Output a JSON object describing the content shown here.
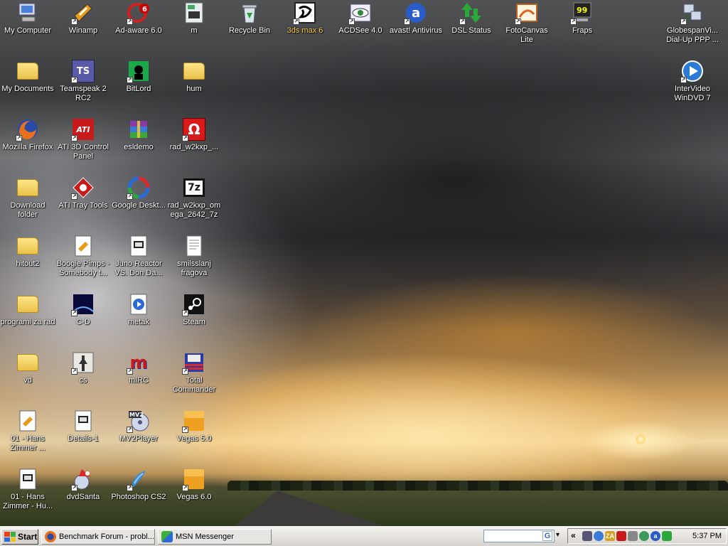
{
  "desktop": {
    "icons": [
      {
        "label": "My Computer",
        "icon": "my-computer-icon"
      },
      {
        "label": "Winamp",
        "icon": "winamp-icon"
      },
      {
        "label": "Ad-aware 6.0",
        "icon": "ad-aware-icon"
      },
      {
        "label": "m",
        "icon": "document-icon"
      },
      {
        "label": "Recycle Bin",
        "icon": "recycle-bin-icon"
      },
      {
        "label": "3ds max 6",
        "icon": "3ds-max-icon"
      },
      {
        "label": "ACDSee 4.0",
        "icon": "acdsee-icon"
      },
      {
        "label": "avast! Antivirus",
        "icon": "avast-icon"
      },
      {
        "label": "DSL Status",
        "icon": "dsl-status-icon"
      },
      {
        "label": "FotoCanvas Lite",
        "icon": "fotocanvas-icon"
      },
      {
        "label": "Fraps",
        "icon": "fraps-icon",
        "badge": "99"
      },
      {
        "label": "GlobespanVi... Dial-Up PPP ...",
        "icon": "network-icon"
      },
      {
        "label": "My Documents",
        "icon": "my-documents-icon"
      },
      {
        "label": "Teamspeak 2 RC2",
        "icon": "teamspeak-icon",
        "badge": "TS"
      },
      {
        "label": "BitLord",
        "icon": "bitlord-icon"
      },
      {
        "label": "hum",
        "icon": "folder-icon"
      },
      {
        "label": "InterVideo WinDVD 7",
        "icon": "windvd-icon"
      },
      {
        "label": "Mozilla Firefox",
        "icon": "firefox-icon"
      },
      {
        "label": "ATI 3D Control Panel",
        "icon": "ati-icon",
        "badge": "ATI"
      },
      {
        "label": "esldemo",
        "icon": "archive-icon"
      },
      {
        "label": "rad_w2kxp_...",
        "icon": "omega-icon",
        "badge": "Ω"
      },
      {
        "label": "Download folder",
        "icon": "folder-icon"
      },
      {
        "label": "ATI Tray Tools",
        "icon": "ati-tray-icon"
      },
      {
        "label": "Google Deskt...",
        "icon": "google-desktop-icon"
      },
      {
        "label": "rad_w2kxp_omega_2642_7z",
        "icon": "7zip-icon",
        "badge": "7z"
      },
      {
        "label": "hitout2",
        "icon": "folder-icon"
      },
      {
        "label": "Boogie Pimps - Somebody t...",
        "icon": "audio-file-icon"
      },
      {
        "label": "Juno Reactor VS. Don Da...",
        "icon": "media-file-icon"
      },
      {
        "label": "smilsslanj fragova",
        "icon": "text-file-icon"
      },
      {
        "label": "programi za rad",
        "icon": "folder-icon"
      },
      {
        "label": "C-D",
        "icon": "cd-icon"
      },
      {
        "label": "metak",
        "icon": "media-player-icon"
      },
      {
        "label": "Steam",
        "icon": "steam-icon"
      },
      {
        "label": "vd",
        "icon": "folder-icon"
      },
      {
        "label": "cs",
        "icon": "counter-strike-icon"
      },
      {
        "label": "mIRC",
        "icon": "mirc-icon",
        "badge": "m"
      },
      {
        "label": "Total Commander",
        "icon": "total-commander-icon"
      },
      {
        "label": "01 - Hans Zimmer ...",
        "icon": "audio-file-icon"
      },
      {
        "label": "Details-1",
        "icon": "media-file-icon"
      },
      {
        "label": "MV2Player",
        "icon": "mv2player-icon",
        "badge": "MV2"
      },
      {
        "label": "Vegas 5.0",
        "icon": "vegas-icon"
      },
      {
        "label": "01 - Hans Zimmer - Hu...",
        "icon": "media-file-icon"
      },
      {
        "label": "dvdSanta",
        "icon": "dvdsanta-icon"
      },
      {
        "label": "Photoshop CS2",
        "icon": "photoshop-icon"
      },
      {
        "label": "Vegas 6.0",
        "icon": "vegas-icon"
      }
    ]
  },
  "taskbar": {
    "start_label": "Start",
    "tasks": [
      {
        "label": "Benchmark Forum - probl...",
        "icon": "firefox-icon"
      },
      {
        "label": "MSN Messenger",
        "icon": "msn-icon"
      }
    ],
    "search_button": "G",
    "tray_expand": "«",
    "clock": "5:37 PM"
  },
  "colors": {
    "desktop_text": "#ffffff",
    "taskbar": "#d6d3ce",
    "folder": "#f0cd5a"
  }
}
